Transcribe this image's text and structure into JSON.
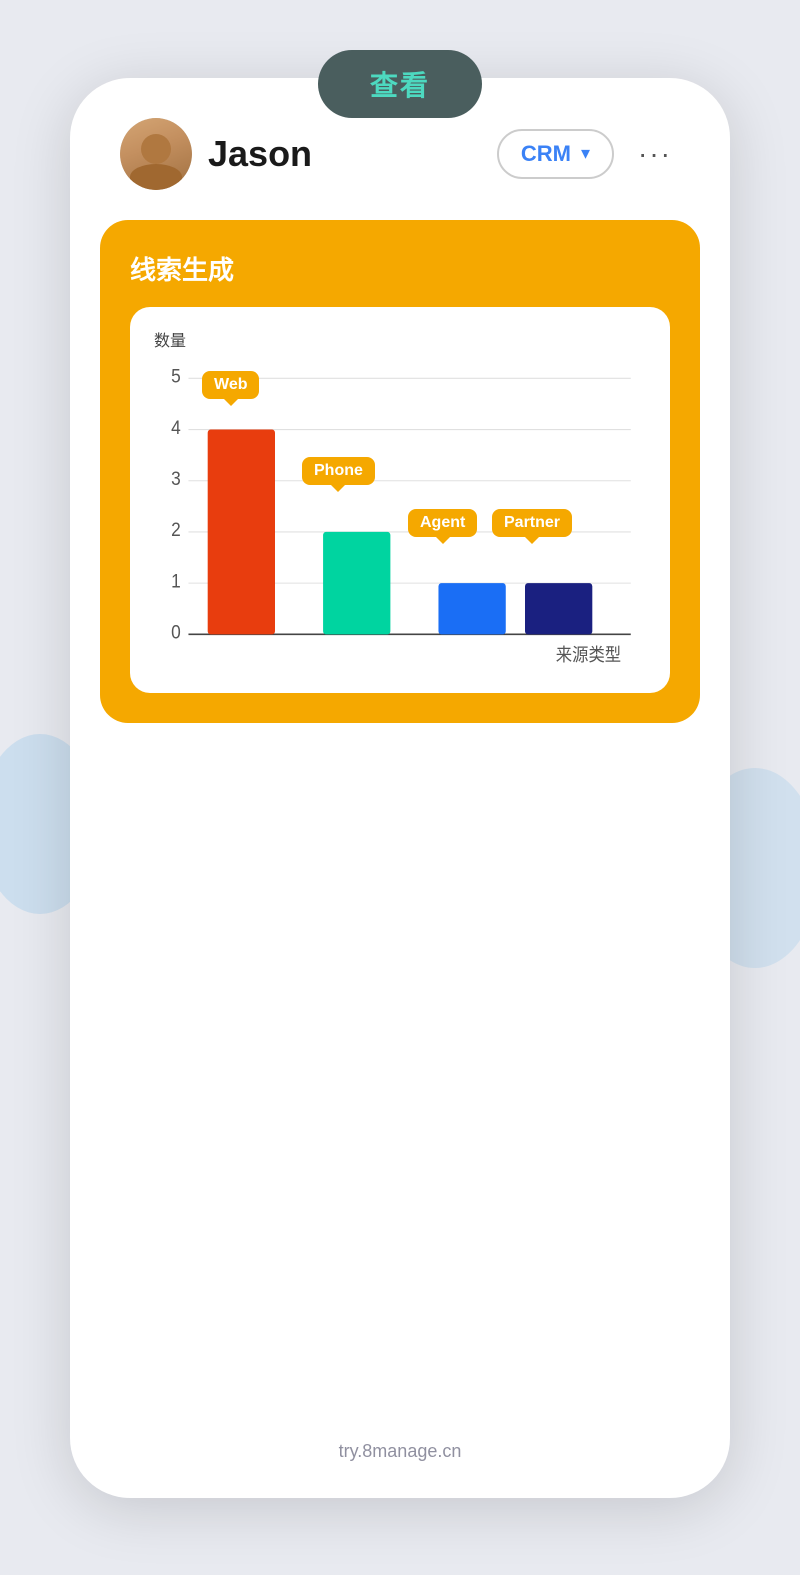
{
  "page": {
    "background_color": "#e8eaf0",
    "footer_url": "try.8manage.cn"
  },
  "top_pill": {
    "label": "查看",
    "bg_color": "#4a5e5e",
    "text_color": "#4dd9c0"
  },
  "header": {
    "user_name": "Jason",
    "dropdown_label": "CRM",
    "more_icon": "···"
  },
  "chart_section": {
    "card_title": "线索生成",
    "card_bg": "#f5a800",
    "y_axis_label": "数量",
    "x_axis_label": "来源类型",
    "y_max": 5,
    "grid_lines": [
      5,
      4,
      3,
      2,
      1,
      0
    ],
    "bars": [
      {
        "label": "Web",
        "value": 4,
        "color": "#e83d0e"
      },
      {
        "label": "Phone",
        "value": 2,
        "color": "#00d4a0"
      },
      {
        "label": "Agent",
        "value": 1,
        "color": "#1a6ef5"
      },
      {
        "label": "Partner",
        "value": 1,
        "color": "#1a2080"
      }
    ]
  }
}
